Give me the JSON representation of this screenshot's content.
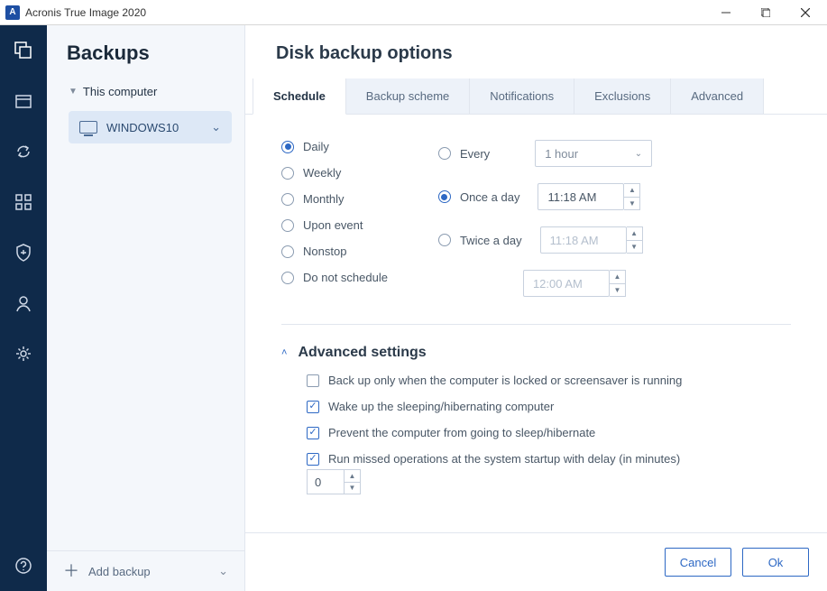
{
  "title": "Acronis True Image 2020",
  "sidebar": {
    "header": "Backups",
    "group_label": "This computer",
    "item_label": "WINDOWS10",
    "add_label": "Add backup"
  },
  "content": {
    "title": "Disk backup options",
    "tabs": [
      "Schedule",
      "Backup scheme",
      "Notifications",
      "Exclusions",
      "Advanced"
    ]
  },
  "schedule": {
    "freq": [
      "Daily",
      "Weekly",
      "Monthly",
      "Upon event",
      "Nonstop",
      "Do not schedule"
    ],
    "mode": {
      "every": "Every",
      "once": "Once a day",
      "twice": "Twice a day"
    },
    "every_value": "1 hour",
    "time1": "11:18 AM",
    "time2": "11:18 AM",
    "time3": "12:00 AM"
  },
  "advanced": {
    "header": "Advanced settings",
    "opts": [
      "Back up only when the computer is locked or screensaver is running",
      "Wake up the sleeping/hibernating computer",
      "Prevent the computer from going to sleep/hibernate",
      "Run missed operations at the system startup with delay (in minutes)"
    ],
    "delay_value": "0"
  },
  "buttons": {
    "cancel": "Cancel",
    "ok": "Ok"
  }
}
